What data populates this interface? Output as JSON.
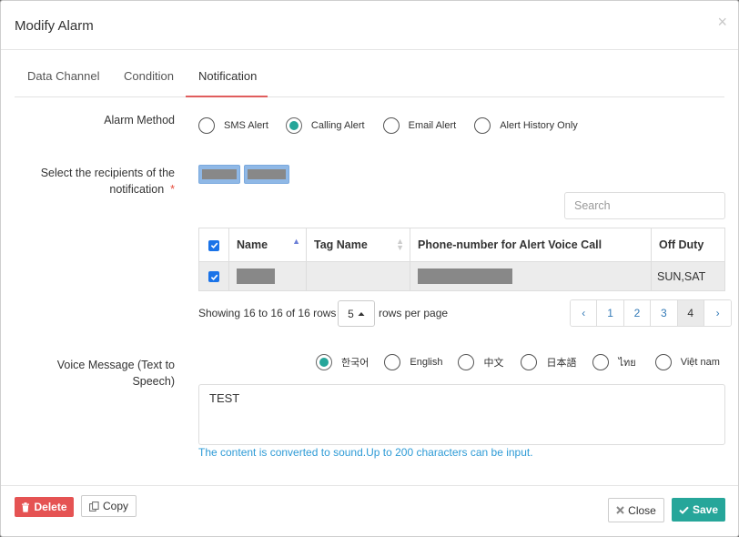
{
  "dialog": {
    "title": "Modify Alarm",
    "close_glyph": "×"
  },
  "tabs": [
    {
      "label": "Data Channel",
      "active": false
    },
    {
      "label": "Condition",
      "active": false
    },
    {
      "label": "Notification",
      "active": true
    }
  ],
  "alarm_method": {
    "label": "Alarm Method",
    "options": [
      {
        "label": "SMS Alert",
        "selected": false
      },
      {
        "label": "Calling Alert",
        "selected": true
      },
      {
        "label": "Email Alert",
        "selected": false
      },
      {
        "label": "Alert History Only",
        "selected": false
      }
    ]
  },
  "recipients": {
    "label_line1": "Select the recipients of the",
    "label_line2": "notification",
    "required_mark": "*"
  },
  "search": {
    "placeholder": "Search",
    "value": ""
  },
  "table": {
    "columns": [
      "Name",
      "Tag Name",
      "Phone-number for Alert Voice Call",
      "Off Duty"
    ],
    "sort_column": "Name",
    "rows": [
      {
        "checked": true,
        "name": "",
        "tag_name": "",
        "phone": "",
        "off_duty": "SUN,SAT"
      }
    ]
  },
  "pagination": {
    "showing": "Showing 16 to 16 of 16 rows",
    "per_page": "5",
    "per_page_suffix": "rows per page",
    "prev": "‹",
    "next": "›",
    "pages": [
      "1",
      "2",
      "3",
      "4"
    ],
    "current": "4"
  },
  "voice_message": {
    "label_line1": "Voice Message (Text to",
    "label_line2": "Speech)",
    "languages": [
      {
        "label": "한국어",
        "selected": true
      },
      {
        "label": "English",
        "selected": false
      },
      {
        "label": "中文",
        "selected": false
      },
      {
        "label": "日本語",
        "selected": false
      },
      {
        "label": "ไทย",
        "selected": false
      },
      {
        "label": "Việt nam",
        "selected": false
      }
    ],
    "text": "TEST",
    "hint": "The content is converted to sound.Up to 200 characters can be input."
  },
  "footer": {
    "delete_label": "Delete",
    "copy_label": "Copy",
    "close_label": "Close",
    "save_label": "Save"
  },
  "colors": {
    "accent_teal": "#26a69a",
    "save_green": "#26a69a",
    "delete_red": "#e55353",
    "tab_underline": "#e05d5d",
    "checkbox_blue": "#1a73e8",
    "hint_blue": "#2e9bd6"
  }
}
